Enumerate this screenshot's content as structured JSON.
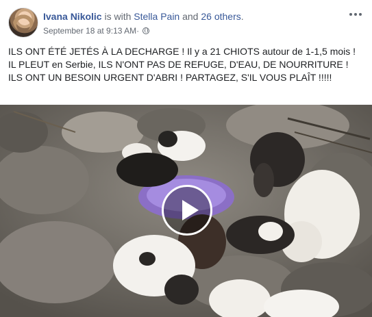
{
  "post": {
    "author": "Ivana Nikolic",
    "with_text": " is with ",
    "tagged": "Stella Pain",
    "and_text": " and ",
    "others": "26 others",
    "period": ".",
    "timestamp": "September 18 at 9:13 AM",
    "separator": " · ",
    "privacy_icon": "globe-icon",
    "more_icon": "more-options-icon",
    "text": "ILS ONT ÉTÉ JETÉS À LA DECHARGE ! Il y a 21 CHIOTS autour de 1-1,5 mois ! IL PLEUT en Serbie, ILS N'ONT PAS DE REFUGE, D'EAU, DE NOURRITURE ! ILS ONT UN BESOIN URGENT D'ABRI ! PARTAGEZ, S'IL VOUS PLAÎT !!!!!",
    "video": {
      "play_icon": "play-icon"
    }
  },
  "colors": {
    "link": "#385898",
    "muted": "#616770",
    "text": "#1c1e21"
  }
}
